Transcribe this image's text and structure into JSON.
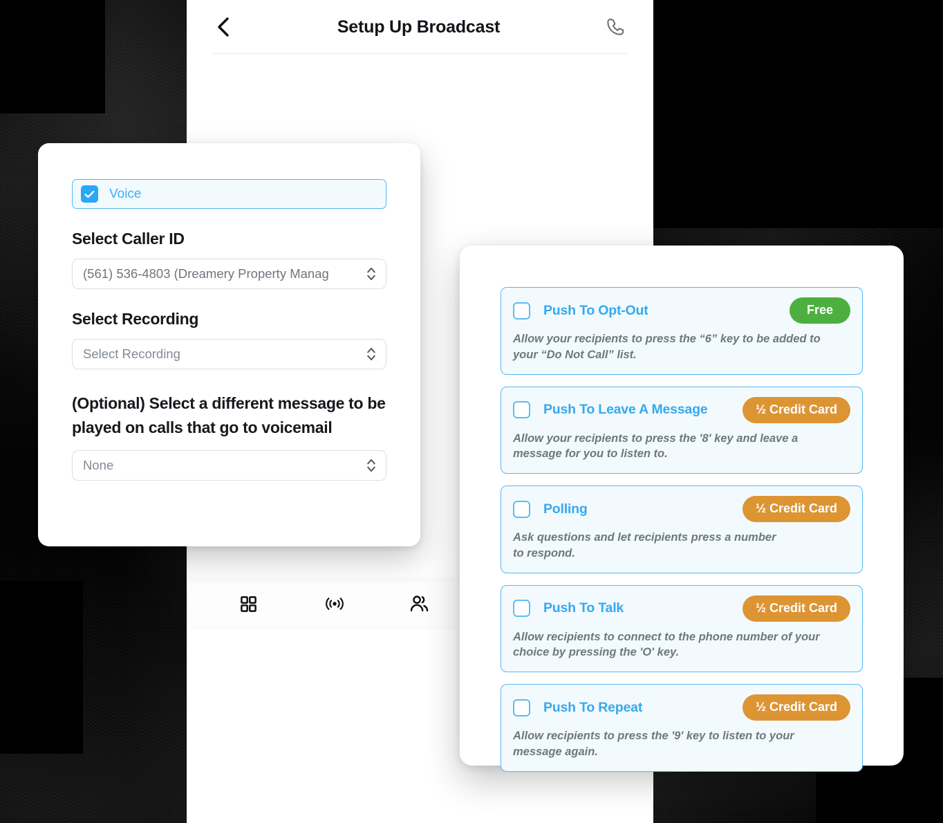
{
  "header": {
    "title": "Setup Up Broadcast",
    "back_icon": "chevron-left-icon",
    "call_icon": "phone-icon"
  },
  "compose_card": {
    "channel_toggle": {
      "label": "Voice",
      "checked": true
    },
    "caller_id": {
      "label": "Select Caller ID",
      "value": "(561) 536-4803 (Dreamery Property Manag"
    },
    "recording": {
      "label": "Select Recording",
      "value": "Select Recording",
      "placeholder": "Select Recording"
    },
    "voicemail": {
      "label": "(Optional) Select a different  message to be played on calls that go to voicemail",
      "value": "None",
      "placeholder": "None"
    }
  },
  "features_panel": {
    "cards": [
      {
        "title": "Push To Opt-Out",
        "checked": false,
        "badge": "Free",
        "badge_type": "free",
        "description": "Allow your recipients to press the “6” key to be  added to\nyour “Do Not Call” list."
      },
      {
        "title": "Push To Leave A Message",
        "checked": false,
        "badge": "½ Credit Card",
        "badge_type": "credit",
        "description": "Allow your recipients to press the '8' key and leave a\nmessage for you to listen to."
      },
      {
        "title": "Polling",
        "checked": false,
        "badge": "½ Credit Card",
        "badge_type": "credit",
        "description": "Ask questions and let recipients press a number\nto respond."
      },
      {
        "title": "Push To Talk",
        "checked": false,
        "badge": "½ Credit Card",
        "badge_type": "credit",
        "description": "Allow recipients to connect to the phone number of your\nchoice by pressing the 'O' key."
      },
      {
        "title": "Push To Repeat",
        "checked": false,
        "badge": "½ Credit Card",
        "badge_type": "credit",
        "description": "Allow recipients to press the '9' key to listen to your\nmessage again."
      }
    ]
  },
  "bottom_nav": {
    "items": [
      {
        "icon": "grid-dashboard-icon",
        "name": "nav-dashboard"
      },
      {
        "icon": "broadcast-signal-icon",
        "name": "nav-broadcast"
      },
      {
        "icon": "contacts-people-icon",
        "name": "nav-contacts"
      },
      {
        "icon": "microphone-icon",
        "name": "nav-recordings"
      },
      {
        "icon": "hamburger-menu-icon",
        "name": "nav-menu"
      }
    ]
  },
  "colors": {
    "accent_blue": "#35a9ef",
    "checkbox_blue": "#2ba7f5",
    "card_bg": "#f3fafd",
    "badge_free_green": "#4caf3f",
    "badge_credit_orange": "#dd9433",
    "text_dark": "#15181c",
    "text_muted": "#6e7781",
    "backdrop": "#000000"
  }
}
